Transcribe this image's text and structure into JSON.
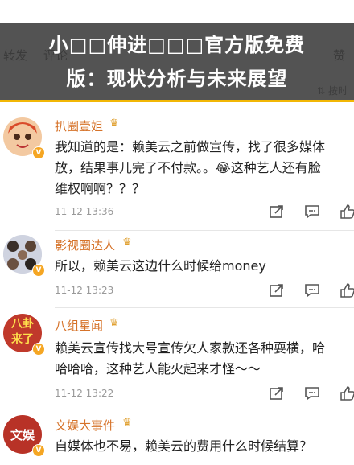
{
  "tabs": [
    "转发",
    "评论",
    "赞"
  ],
  "sort_label": "按时",
  "overlay_title": {
    "line1": "小□□伸进□□□官方版免费",
    "line2": "版：现状分析与未来展望"
  },
  "colors": {
    "overlay_bg": "#373737",
    "accent": "#f2b705",
    "username": "#d6732a",
    "badge": "#f5a623"
  },
  "comments": [
    {
      "username": "扒圈壹姐",
      "text1": "我知道的是：赖美云之前做宣传，找了很多媒体",
      "text2": "放，结果事儿完了不付款。。😂这种艺人还有脸",
      "text3": "维权啊啊？？？",
      "time": "11-12 13:36"
    },
    {
      "username": "影视圈达人",
      "text1": "所以，赖美云这边什么时候给money",
      "time": "11-12 13:23"
    },
    {
      "username": "八组星闻",
      "text1": "赖美云宣传找大号宣传欠人家款还各种耍横，哈",
      "text2": "哈哈哈，这种艺人能火起来才怪～～",
      "time": "11-12 13:22",
      "avatar_text1": "八卦",
      "avatar_text2": "来了"
    },
    {
      "username": "文娱大事件",
      "text1": "自媒体也不易，赖美云的费用什么时候结算？",
      "avatar_text1": "文娱"
    }
  ],
  "icons": [
    "share-icon",
    "comment-icon",
    "like-icon",
    "crown-icon",
    "verified-badge-icon"
  ]
}
